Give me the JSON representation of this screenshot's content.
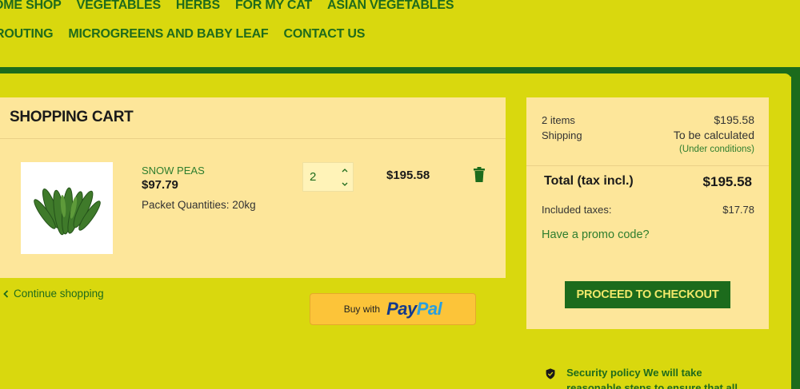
{
  "nav": {
    "row1": [
      "OME SHOP",
      "VEGETABLES",
      "HERBS",
      "FOR MY CAT",
      "ASIAN VEGETABLES"
    ],
    "row2": [
      "ROUTING",
      "MICROGREENS AND BABY LEAF",
      "CONTACT US"
    ]
  },
  "cart": {
    "title": "SHOPPING CART",
    "item": {
      "name": "SNOW PEAS",
      "price": "$97.79",
      "attribute": "Packet Quantities: 20kg",
      "quantity": "2",
      "line_total": "$195.58"
    },
    "continue_label": "Continue shopping",
    "paypal": {
      "buy_with": "Buy with",
      "pay": "Pay",
      "pal": "Pal"
    }
  },
  "summary": {
    "items_label": "2 items",
    "items_value": "$195.58",
    "shipping_label": "Shipping",
    "shipping_value": "To be calculated",
    "shipping_note": "(Under conditions)",
    "total_label": "Total (tax incl.)",
    "total_value": "$195.58",
    "taxes_label": "Included taxes:",
    "taxes_value": "$17.78",
    "promo_label": "Have a promo code?",
    "checkout_label": "PROCEED TO CHECKOUT"
  },
  "security": {
    "text": "Security policy We will take reasonable steps to ensure that all"
  },
  "colors": {
    "background": "#d9d80e",
    "brand_green": "#1c6b1c",
    "card": "#fde69a",
    "paypal_yellow": "#fcc439"
  },
  "icons": [
    "trash-icon",
    "chevron-left-icon",
    "chevron-up-icon",
    "chevron-down-icon",
    "shield-check-icon"
  ]
}
